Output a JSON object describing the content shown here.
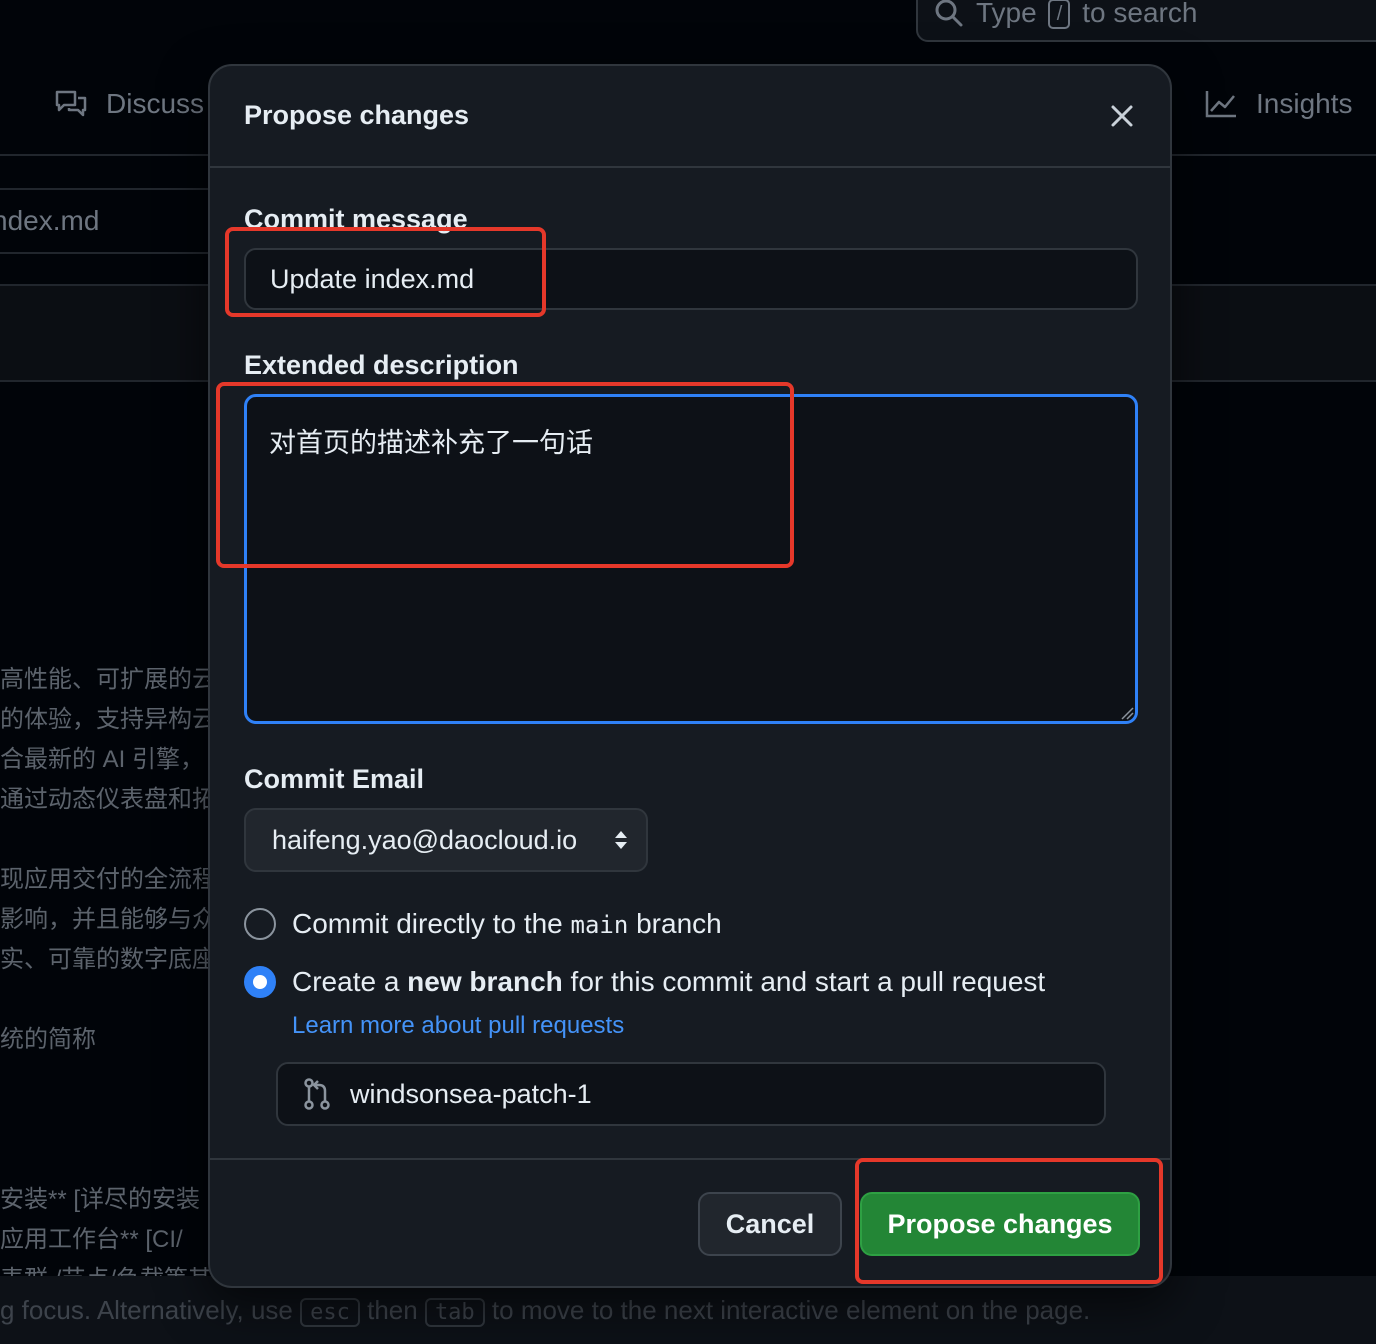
{
  "background": {
    "search_prefix": "Type",
    "search_kbd": "/",
    "search_suffix": "to search",
    "nav_discussions": "Discuss",
    "nav_insights": "Insights",
    "file_name": "ndex.md",
    "text_block_1": [
      "高性能、可扩展的云",
      "的体验，支持异构云",
      "合最新的 AI 引擎，",
      "通过动态仪表盘和拓"
    ],
    "text_block_2": [
      "现应用交付的全流程",
      "影响，并且能够与众",
      "实、可靠的数字底座，"
    ],
    "text_block_3": "统的简称",
    "text_block_4": [
      "安装** [详尽的安装",
      "应用工作台** [CI/",
      "表群 /节点/负载等其"
    ],
    "focus_text_1": "g focus. Alternatively, use ",
    "focus_key_esc": "esc",
    "focus_text_2": " then ",
    "focus_key_tab": "tab",
    "focus_text_3": " to move to the next interactive element on the page."
  },
  "modal": {
    "title": "Propose changes",
    "commit_message_label": "Commit message",
    "commit_message_value": "Update index.md",
    "extended_description_label": "Extended description",
    "extended_description_value": "对首页的描述补充了一句话",
    "commit_email_label": "Commit Email",
    "commit_email_value": "haifeng.yao@daocloud.io",
    "option_direct_prefix": "Commit directly to the ",
    "option_direct_branch": "main",
    "option_direct_suffix": " branch",
    "option_new_prefix": "Create a ",
    "option_new_bold": "new branch",
    "option_new_suffix": " for this commit and start a pull request",
    "learn_more": "Learn more about pull requests",
    "branch_name": "windsonsea-patch-1",
    "cancel_label": "Cancel",
    "submit_label": "Propose changes"
  },
  "colors": {
    "primary_button": "#238636",
    "focus_border": "#2f81f7",
    "link": "#4493f8",
    "annotation": "#e5382a"
  },
  "icons": [
    "search-icon",
    "discussions-icon",
    "insights-graph-icon",
    "close-icon",
    "select-chevrons-icon",
    "git-branch-icon"
  ]
}
